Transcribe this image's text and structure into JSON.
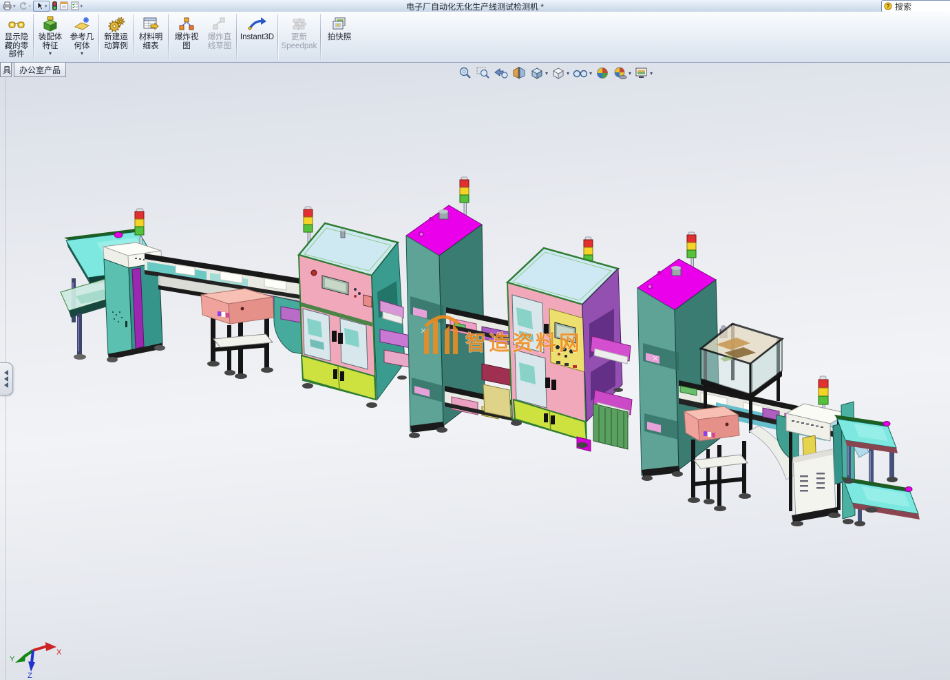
{
  "window": {
    "title": "电子厂自动化无化生产线测试检测机 *",
    "search_label": "搜索"
  },
  "quick_access": {
    "icons": [
      "print",
      "undo",
      "select",
      "performance-light",
      "properties",
      "options"
    ]
  },
  "ribbon": {
    "buttons": [
      {
        "label": "显示隐\n藏的零\n部件",
        "icon": "show-hidden-components",
        "enabled": true,
        "dropdown": false
      },
      {
        "label": "装配体\n特征",
        "icon": "assembly-features",
        "enabled": true,
        "dropdown": true
      },
      {
        "label": "参考几\n何体",
        "icon": "reference-geometry",
        "enabled": true,
        "dropdown": true
      },
      {
        "label": "新建运\n动算例",
        "icon": "new-motion-study",
        "enabled": true,
        "dropdown": false
      },
      {
        "label": "材料明\n细表",
        "icon": "bill-of-materials",
        "enabled": true,
        "dropdown": false
      },
      {
        "label": "爆炸视\n图",
        "icon": "exploded-view",
        "enabled": true,
        "dropdown": false
      },
      {
        "label": "爆炸直\n线草图",
        "icon": "explode-line-sketch",
        "enabled": false,
        "dropdown": false
      },
      {
        "label": "Instant3D",
        "icon": "instant3d",
        "enabled": true,
        "dropdown": false
      },
      {
        "label": "更新\nSpeedpak",
        "icon": "update-speedpak",
        "enabled": false,
        "dropdown": false
      },
      {
        "label": "拍快照",
        "icon": "take-snapshot",
        "enabled": true,
        "dropdown": false
      }
    ]
  },
  "tabs": {
    "items": [
      {
        "label": "具",
        "active": false
      },
      {
        "label": "办公室产品",
        "active": true
      }
    ]
  },
  "headsup": {
    "icons": [
      {
        "name": "zoom-to-fit",
        "dropdown": false
      },
      {
        "name": "zoom-to-area",
        "dropdown": false
      },
      {
        "name": "previous-view",
        "dropdown": false
      },
      {
        "name": "section-view",
        "dropdown": false
      },
      {
        "name": "view-orientation",
        "dropdown": true
      },
      {
        "name": "display-style",
        "dropdown": true
      },
      {
        "name": "hide-show-items",
        "dropdown": true
      },
      {
        "name": "edit-appearance",
        "dropdown": false
      },
      {
        "name": "apply-scene",
        "dropdown": true
      },
      {
        "name": "view-settings",
        "dropdown": true
      }
    ]
  },
  "viewport": {
    "watermark": "智造资料网",
    "triad": {
      "x": "X",
      "y": "Y",
      "z": "Z"
    }
  },
  "colors": {
    "machine_teal": "#5fa396",
    "cabinet_teal": "#5cc0b0",
    "top_magenta": "#ea00ea",
    "panel_pink": "#f0a8ba",
    "door_yellow_green": "#cde23f",
    "control_panel_yellow": "#ecdf6d",
    "conveyor_cyan": "#7ce8e0",
    "control_box_pink": "#f0a39d",
    "stack_red": "#e03030",
    "stack_yellow": "#f5d327",
    "stack_green": "#57c13d",
    "watermark_orange": "#f08c1e"
  }
}
